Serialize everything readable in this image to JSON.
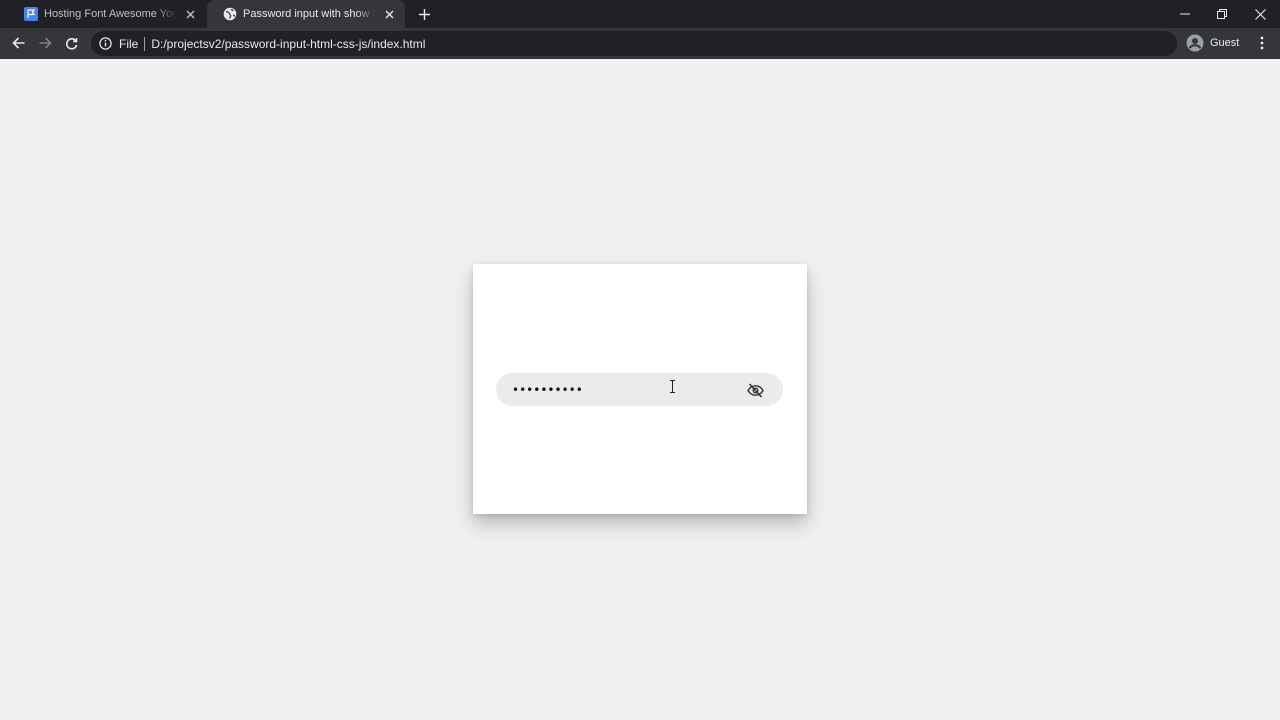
{
  "browser": {
    "tabs": [
      {
        "title": "Hosting Font Awesome Yourself |",
        "active": false,
        "favicon": "flag-icon"
      },
      {
        "title": "Password input with show hide t",
        "active": true,
        "favicon": "globe-icon"
      }
    ],
    "address_bar": {
      "scheme_label": "File",
      "url": "D:/projectsv2/password-input-html-css-js/index.html"
    },
    "profile_label": "Guest",
    "colors": {
      "frame": "#202124",
      "toolbar": "#35363a",
      "accent_favicon": "#4285f4"
    }
  },
  "page": {
    "password_field": {
      "value": "••••••••••",
      "toggle_icon": "eye-slash-icon"
    },
    "colors": {
      "background": "#f0f0f0",
      "card": "#ffffff",
      "field": "#ebebeb"
    }
  }
}
